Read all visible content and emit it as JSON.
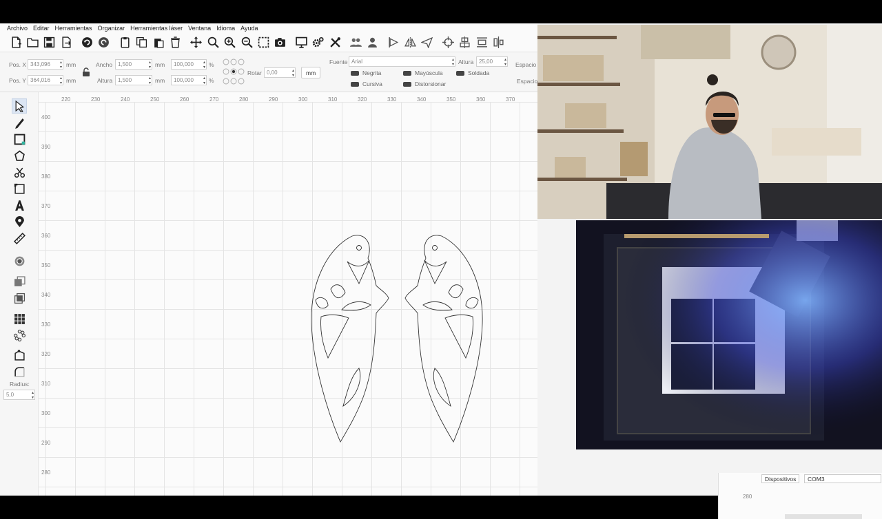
{
  "menu": [
    "Archivo",
    "Editar",
    "Herramientas",
    "Organizar",
    "Herramientas láser",
    "Ventana",
    "Idioma",
    "Ayuda"
  ],
  "toolbar_icons": [
    "new-file-icon",
    "open-folder-icon",
    "save-icon",
    "export-icon",
    "undo-icon",
    "redo-icon",
    "cut-icon",
    "copy-icon",
    "paste-icon",
    "delete-icon",
    "move-icon",
    "zoom-in-icon",
    "zoom-plus-icon",
    "zoom-minus-icon",
    "frame-icon",
    "camera-icon",
    "monitor-icon",
    "settings-icon",
    "tools-icon",
    "group-icon",
    "user-icon",
    "align-left-icon",
    "mirror-icon",
    "send-icon",
    "target-icon",
    "align-center-icon",
    "distribute-icon",
    "align-vertical-icon"
  ],
  "props": {
    "pos_x_label": "Pos. X",
    "pos_x_value": "343,096",
    "pos_y_label": "Pos. Y",
    "pos_y_value": "364,016",
    "unit_mm": "mm",
    "percent": "%",
    "width_label": "Ancho",
    "width_value": "1,500",
    "width_pct": "100,000",
    "height_label": "Altura",
    "height_value": "1,500",
    "height_pct": "100,000",
    "rotate_label": "Rotar",
    "rotate_value": "0,00",
    "mm_button": "mm",
    "font_label": "Fuente",
    "font_value": "Arial",
    "font_height_label": "Altura",
    "font_height_value": "25,00",
    "spacing_label": "Espacio",
    "spacing_label_2": "Espacio",
    "bold": "Negrita",
    "italic": "Cursiva",
    "uppercase": "Mayúscula",
    "distort": "Distorsionar",
    "weld": "Soldada"
  },
  "left_tools": {
    "radius_label": "Radius:",
    "radius_value": "5,0"
  },
  "ruler": {
    "x": [
      "220",
      "230",
      "240",
      "250",
      "260",
      "270",
      "280",
      "290",
      "300",
      "310",
      "320",
      "330",
      "340",
      "350",
      "360",
      "370"
    ],
    "y": [
      "400",
      "390",
      "380",
      "370",
      "360",
      "350",
      "340",
      "330",
      "320",
      "310",
      "300",
      "290",
      "280"
    ]
  },
  "right_panel": {
    "devices_tab": "Dispositivos",
    "port_value": "COM3",
    "ruler_tick": "280"
  }
}
